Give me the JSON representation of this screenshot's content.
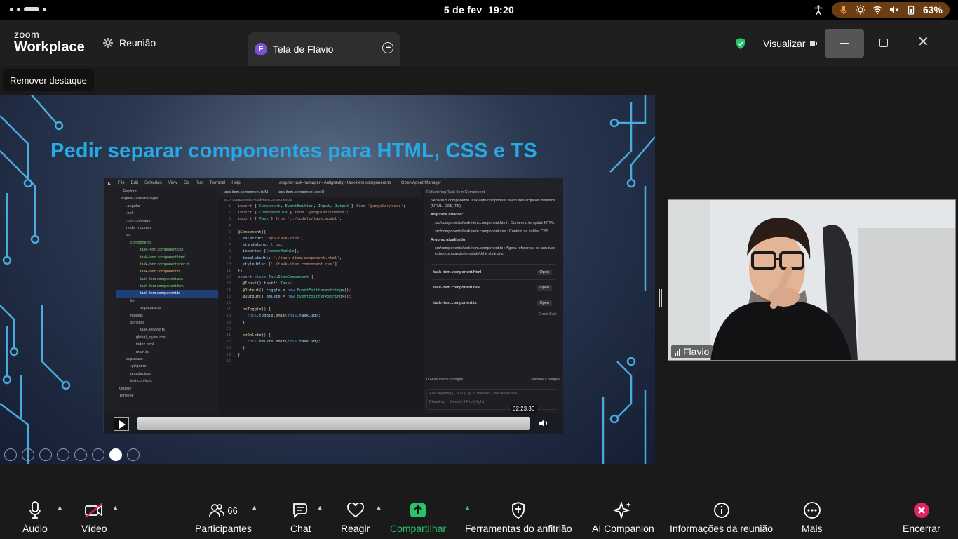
{
  "status_bar": {
    "date": "5 de fev",
    "time": "19:20",
    "battery": "63%"
  },
  "titlebar": {
    "logo_line1": "zoom",
    "logo_line2": "Workplace",
    "meeting_tab": "Reunião",
    "share_tab": "Tela de Flavio",
    "share_avatar_letter": "F",
    "view_button": "Visualizar"
  },
  "stage": {
    "remove_highlight": "Remover destaque",
    "slide_title": "Pedir separar componentes para HTML, CSS e TS",
    "participant_name": "Flavio"
  },
  "ide": {
    "menu": [
      "File",
      "Edit",
      "Selection",
      "View",
      "Go",
      "Run",
      "Terminal",
      "Help"
    ],
    "window_title": "angular-task-manager - Antigravity - task-item.component.ts",
    "agent_manager": "Open Agent Manager",
    "explorer_header": "Explorer",
    "tree": [
      "angular-task-manager",
      ".angular",
      ".bolt",
      ".nyc-coverage",
      "node_modules",
      "src",
      "components",
      "task-form.component.css",
      "task-form.component.html",
      "task-form.component.spec.ts",
      "task-form.component.ts",
      "task-item.component.css",
      "task-item.component.html",
      "task-item.component.ts",
      "lib",
      "supabase.ts",
      "models",
      "services",
      "task.service.ts",
      "global_styles.css",
      "index.html",
      "main.ts",
      "supabase",
      ".gitignore",
      "angular.json",
      "jest.config.ts",
      "Outline",
      "Timeline"
    ],
    "selected_file": "task-item.component.ts",
    "tabs": [
      "task-item.component.ts M",
      "task-item.component.css U"
    ],
    "breadcrumb": "src > components > task-item.component.ts",
    "panel_title": "Refactoring Task Item Component",
    "panel_intro": "Separei o componente task-item.component.ts em três arquivos distintos (HTML, CSS, TS).",
    "panel_created": "Arquivos criados:",
    "panel_created_1": "src/components/task-item.component.html : Contém o template HTML.",
    "panel_created_2": "src/components/task-item.component.css : Contém os estilos CSS.",
    "panel_updated": "Arquivo atualizado:",
    "panel_updated_1": "src/components/task-item.component.ts : Agora referencia os arquivos externos usando templateUrl e styleUrls.",
    "files": [
      "task-item.component.html",
      "task-item.component.css",
      "task-item.component.ts"
    ],
    "open_label": "Open",
    "feedback": "Good  Bad",
    "files_changed": "0 Files With Changes",
    "review_changes": "Review Changes",
    "ask_placeholder": "Ask anything (Ctrl+L), @ to mention, / for workflows",
    "planning": "Planning",
    "model": "Gemini 3 Pro (High)",
    "timecode": "02:23,36"
  },
  "toolbar": {
    "audio": "Áudio",
    "video": "Vídeo",
    "participants": "Participantes",
    "participants_count": "66",
    "chat": "Chat",
    "react": "Reagir",
    "share": "Compartilhar",
    "host_tools": "Ferramentas do anfitrião",
    "ai_companion": "AI Companion",
    "meeting_info": "Informações da reunião",
    "more": "Mais",
    "end": "Encerrar"
  },
  "colors": {
    "share_green": "#27c46b",
    "end_red": "#e0245e",
    "title_blue": "#27a9e6",
    "avatar_purple": "#7b4fd6"
  }
}
